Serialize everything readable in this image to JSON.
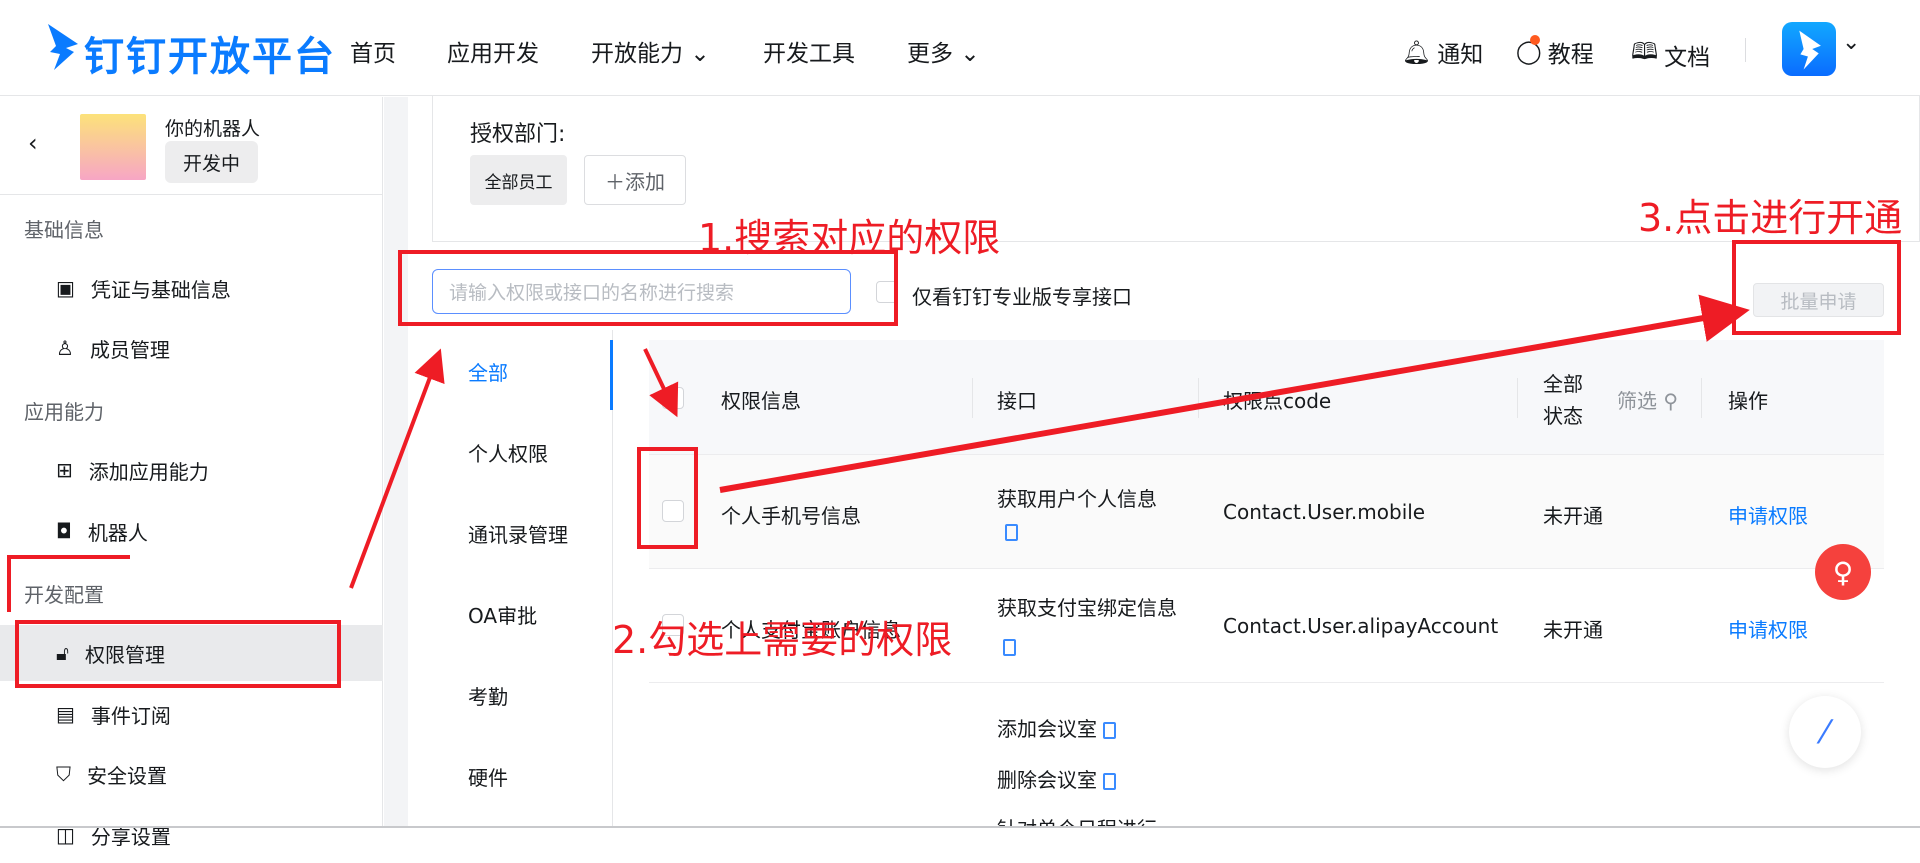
{
  "header": {
    "logo": "钉钉开放平台",
    "nav": [
      "首页",
      "应用开发",
      "开放能力",
      "开发工具",
      "更多"
    ],
    "notify": "通知",
    "tutorial": "教程",
    "docs": "文档"
  },
  "app": {
    "name": "你的机器人",
    "status": "开发中"
  },
  "sidebar": {
    "sections": [
      {
        "title": "基础信息",
        "items": [
          "凭证与基础信息",
          "成员管理"
        ]
      },
      {
        "title": "应用能力",
        "items": [
          "添加应用能力",
          "机器人"
        ]
      },
      {
        "title": "开发配置",
        "items": [
          "权限管理",
          "事件订阅",
          "安全设置",
          "分享设置"
        ]
      }
    ]
  },
  "auth": {
    "label": "授权部门:",
    "chip": "全部员工",
    "add": "添加"
  },
  "search": {
    "placeholder": "请输入权限或接口的名称进行搜索",
    "pro_only": "仅看钉钉专业版专享接口",
    "batch": "批量申请"
  },
  "tabs": [
    "全部",
    "个人权限",
    "通讯录管理",
    "OA审批",
    "考勤",
    "硬件"
  ],
  "table": {
    "headers": {
      "info": "权限信息",
      "api": "接口",
      "code": "权限点code",
      "status_all": "全部",
      "status": "状态",
      "filter": "筛选",
      "op": "操作"
    },
    "rows": [
      {
        "info": "个人手机号信息",
        "api": [
          "获取用户个人信息"
        ],
        "code": "Contact.User.mobile",
        "status": "未开通",
        "op": "申请权限"
      },
      {
        "info": "个人支付宝账户信息",
        "api": [
          "获取支付宝绑定信息"
        ],
        "code": "Contact.User.alipayAccount",
        "status": "未开通",
        "op": "申请权限"
      },
      {
        "info": "",
        "api": [
          "添加会议室",
          "删除会议室",
          "针对单个日程进行"
        ],
        "code": "",
        "status": "",
        "op": ""
      }
    ]
  },
  "annotations": {
    "step1": "1.搜索对应的权限",
    "step2": "2.勾选上需要的权限",
    "step3": "3.点击进行开通"
  },
  "colors": {
    "accent": "#0a7bff",
    "annotation": "#ee1c25"
  }
}
